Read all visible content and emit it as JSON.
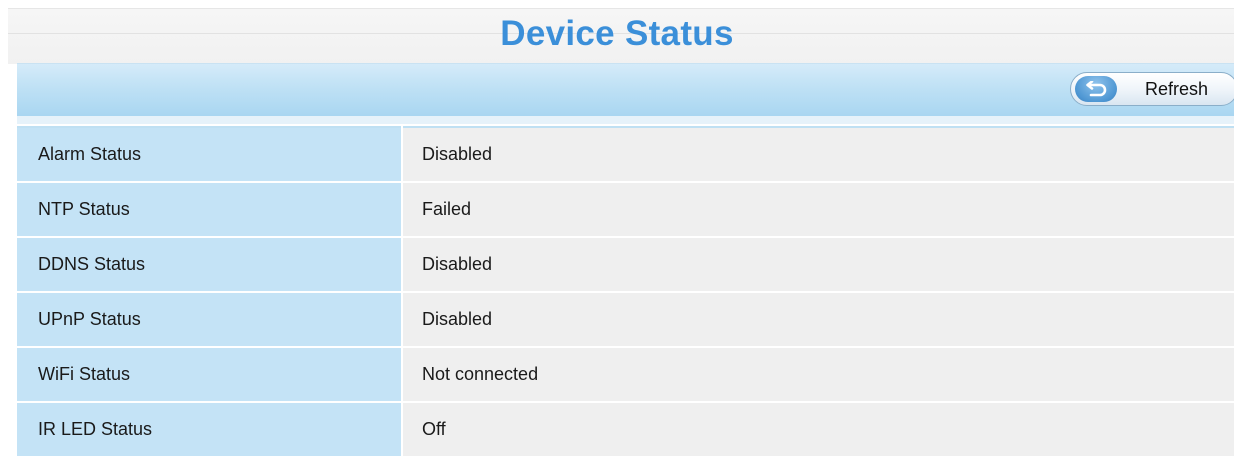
{
  "page": {
    "title": "Device Status"
  },
  "toolbar": {
    "refresh_label": "Refresh",
    "refresh_icon": "refresh-arrow-icon"
  },
  "status_rows": [
    {
      "label": "Alarm Status",
      "value": "Disabled"
    },
    {
      "label": "NTP Status",
      "value": "Failed"
    },
    {
      "label": "DDNS Status",
      "value": "Disabled"
    },
    {
      "label": "UPnP Status",
      "value": "Disabled"
    },
    {
      "label": "WiFi Status",
      "value": "Not connected"
    },
    {
      "label": "IR LED Status",
      "value": "Off"
    }
  ],
  "colors": {
    "title": "#3b8fd9",
    "label_cell": "#c4e3f6",
    "value_cell": "#efefef",
    "toolbar": "#bfe1f5"
  }
}
